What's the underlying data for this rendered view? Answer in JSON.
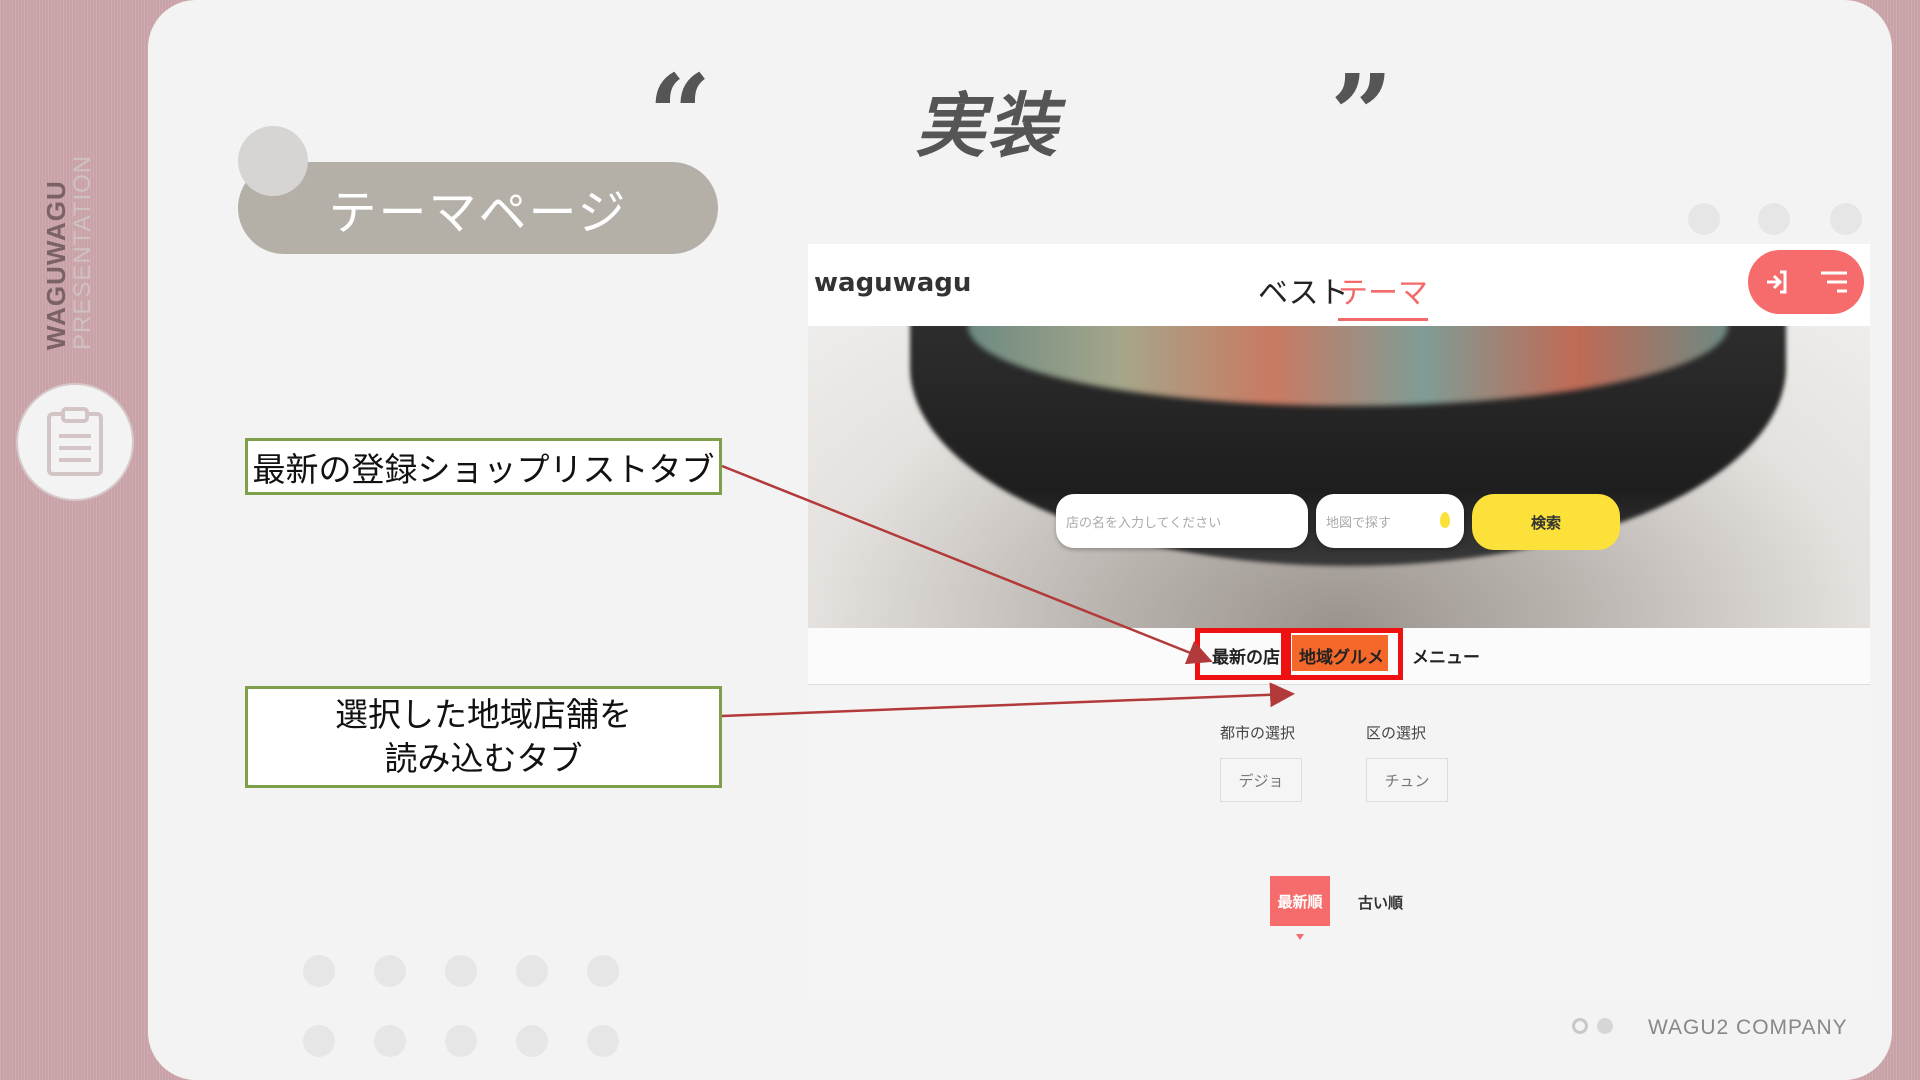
{
  "sidebar": {
    "brand": "WAGUWAGU",
    "subtitle": "PRESENTATION",
    "icon": "clipboard-icon"
  },
  "slide": {
    "heading": "実装",
    "open_quote": "“",
    "close_quote": "”",
    "section_pill": "テーマページ"
  },
  "callouts": {
    "newest_tab": "最新の登録ショップリストタブ",
    "region_tab_line1": "選択した地域店舗を",
    "region_tab_line2": "読み込むタブ"
  },
  "app": {
    "logo": "waguwagu",
    "nav": {
      "best": "ベスト",
      "theme": "テーマ"
    },
    "header_icons": [
      "login-icon",
      "menu-icon"
    ],
    "search": {
      "shop_placeholder": "店の名を入力してください",
      "map_placeholder": "地図で探す",
      "button": "検索"
    },
    "tabs": {
      "newest": "最新の店",
      "region": "地域グルメ",
      "menu": "メニュー"
    },
    "filters": {
      "city_label": "都市の選択",
      "city_value": "デジョ",
      "district_label": "区の選択",
      "district_value": "チュン"
    },
    "sort": {
      "newest": "最新順",
      "oldest": "古い順"
    }
  },
  "footer": {
    "company": "WAGU2 COMPANY"
  },
  "colors": {
    "accent": "#f66b6b",
    "callout_border": "#7fa04a",
    "highlight_box": "#ee1111",
    "search_button": "#fbe13a",
    "region_tab_bg": "#f4682a"
  }
}
